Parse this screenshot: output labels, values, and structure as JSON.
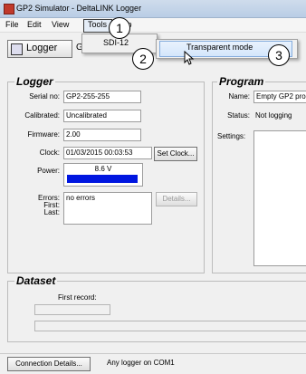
{
  "window": {
    "title": "GP2 Simulator - DeltaLINK Logger"
  },
  "menu": {
    "file": "File",
    "edit": "Edit",
    "view": "View",
    "tools": "Tools",
    "help": "Help"
  },
  "toolbar": {
    "logger_label": "Logger",
    "tab_partial": "G"
  },
  "dropdown": {
    "sdi12": "SDI-12",
    "arrow": "▶"
  },
  "submenu": {
    "transparent_mode": "Transparent mode"
  },
  "callouts": [
    "1",
    "2",
    "3"
  ],
  "logger": {
    "title": "Logger",
    "serial_label": "Serial no:",
    "serial_value": "GP2-255-255",
    "calibrated_label": "Calibrated:",
    "calibrated_value": "Uncalibrated",
    "firmware_label": "Firmware:",
    "firmware_value": "2.00",
    "clock_label": "Clock:",
    "clock_value": "01/03/2015 00:03:53",
    "set_clock": "Set Clock...",
    "power_label": "Power:",
    "power_value": "8.6 V",
    "errors_label": "Errors:",
    "errors_value": "no errors",
    "first_label": "First:",
    "last_label": "Last:",
    "details": "Details..."
  },
  "program": {
    "title": "Program",
    "name_label": "Name:",
    "name_value": "Empty GP2 prog",
    "status_label": "Status:",
    "status_value": "Not logging",
    "settings_label": "Settings:"
  },
  "dataset": {
    "title": "Dataset",
    "first_record_label": "First record:"
  },
  "status": {
    "connection_details": "Connection Details...",
    "message": "Any logger on COM1"
  },
  "colors": {
    "power_bar": "#0016e0"
  }
}
